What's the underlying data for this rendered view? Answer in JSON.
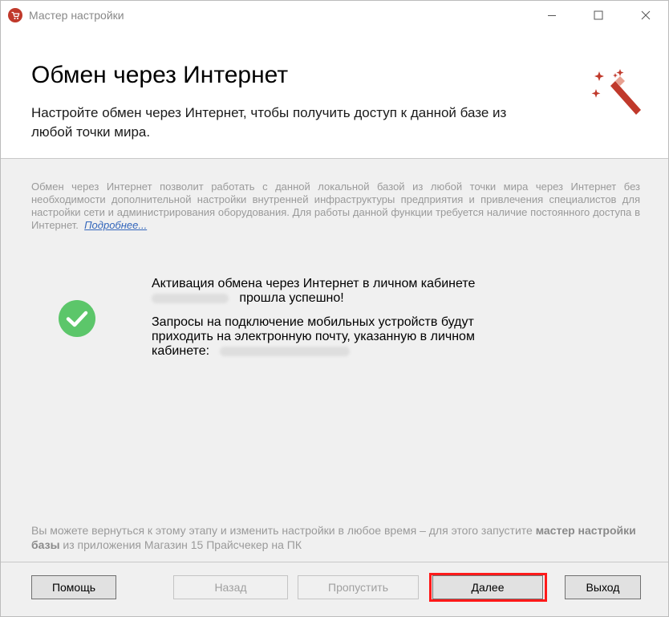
{
  "window": {
    "title": "Мастер настройки",
    "icon": "app-cart-icon",
    "controls": [
      "minimize-icon",
      "maximize-icon",
      "close-icon"
    ]
  },
  "header": {
    "title": "Обмен через Интернет",
    "subtitle": "Настройте обмен через Интернет, чтобы получить доступ к данной базе из любой точки мира.",
    "icon": "magic-wand-icon"
  },
  "info": {
    "text": "Обмен через Интернет позволит работать с данной локальной базой из любой точки мира через Интернет без необходимости дополнительной настройки внутренней инфраструктуры предприятия и привлечения специалистов для настройки сети и администрирования оборудования. Для работы данной функции требуется наличие постоянного доступа в Интернет.",
    "link": "Подробнее..."
  },
  "status": {
    "icon": "success-check-icon",
    "line1": "Активация обмена через Интернет в личном кабинете",
    "line2_suffix": "прошла успешно!",
    "line3": "Запросы на подключение мобильных устройств будут приходить на электронную почту, указанную в личном кабинете:"
  },
  "footer": {
    "text_before": "Вы можете вернуться к этому этапу и изменить настройки в любое время – для этого запустите ",
    "bold": "мастер настройки базы",
    "text_after": " из приложения Магазин 15 Прайсчекер на ПК"
  },
  "buttons": {
    "help": "Помощь",
    "back": "Назад",
    "skip": "Пропустить",
    "next": "Далее",
    "exit": "Выход"
  },
  "colors": {
    "accent_red": "#c0392b",
    "success_green": "#5cc66a",
    "link_blue": "#3366bb",
    "highlight": "#ff1a1a"
  }
}
